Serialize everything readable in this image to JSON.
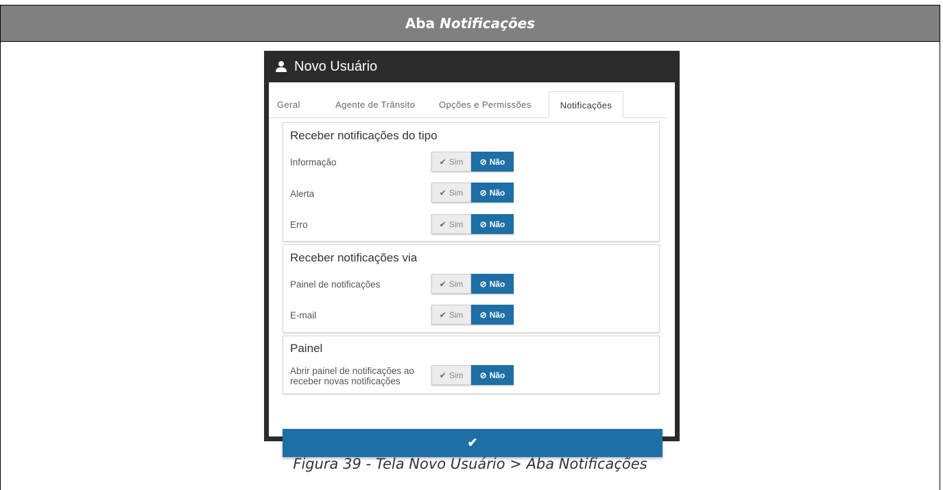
{
  "document": {
    "header_prefix": "Aba ",
    "header_emphasis": "Notificações",
    "caption": "Figura 39 - Tela Novo Usuário > Aba Notificações"
  },
  "dialog": {
    "title": "Novo Usuário",
    "title_icon": "user-icon",
    "tabs": [
      {
        "label": "Geral",
        "active": false
      },
      {
        "label": "Agente de Trânsito",
        "active": false
      },
      {
        "label": "Opções e Permissões",
        "active": false
      },
      {
        "label": "Notificações",
        "active": true
      }
    ],
    "panels": [
      {
        "title": "Receber notificações do tipo",
        "rows": [
          {
            "label": "Informação",
            "value": "Não"
          },
          {
            "label": "Alerta",
            "value": "Não"
          },
          {
            "label": "Erro",
            "value": "Não"
          }
        ]
      },
      {
        "title": "Receber notificações via",
        "rows": [
          {
            "label": "Painel de notificações",
            "value": "Não"
          },
          {
            "label": "E-mail",
            "value": "Não"
          }
        ]
      },
      {
        "title": "Painel",
        "rows": [
          {
            "label_line1": "Abrir painel de notificações ao",
            "label_line2": "receber novas notificações",
            "value": "Não"
          }
        ]
      }
    ],
    "toggle": {
      "yes_label": "Sim",
      "no_label": "Não",
      "yes_icon": "check-icon",
      "no_icon": "ban-icon"
    },
    "confirm_icon": "check-icon"
  },
  "colors": {
    "accent": "#1d6fa5",
    "header_bg": "#808080",
    "dialog_frame": "#2b2b2b"
  }
}
